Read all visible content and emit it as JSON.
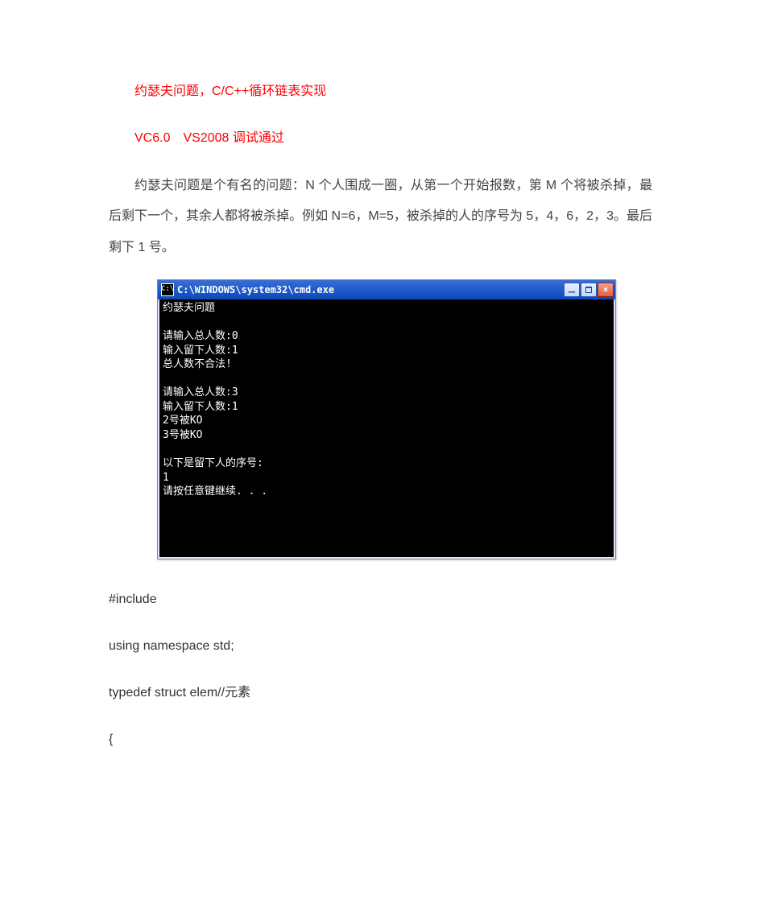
{
  "heading1": "约瑟夫问题，C/C++循环链表实现",
  "heading2": "VC6.0　VS2008 调试通过",
  "para1": "约瑟夫问题是个有名的问题：N 个人围成一圈，从第一个开始报数，第 M 个将被杀掉，最后剩下一个，其余人都将被杀掉。例如 N=6，M=5，被杀掉的人的序号为 5，4，6，2，3。最后剩下 1 号。",
  "terminal": {
    "title": "C:\\WINDOWS\\system32\\cmd.exe",
    "icon_label": "C:\\",
    "lines": "约瑟夫问题\n\n请输入总人数:0\n输入留下人数:1\n总人数不合法!\n\n请输入总人数:3\n输入留下人数:1\n2号被KO\n3号被KO\n\n以下是留下人的序号:\n1\n请按任意键继续. . ."
  },
  "code": {
    "l1": "#include",
    "l2": "using  namespace  std;",
    "l3": "typedef  struct  elem//元素",
    "l4": "{"
  }
}
